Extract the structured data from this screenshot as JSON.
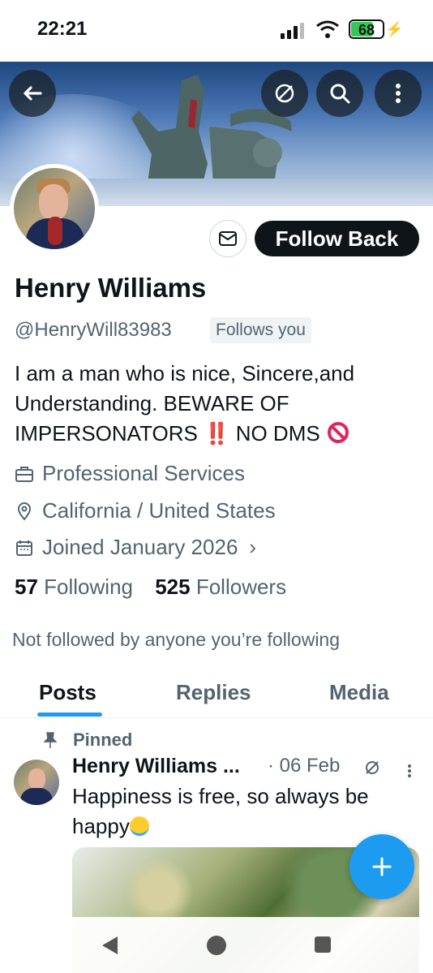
{
  "status_bar": {
    "time": "22:21",
    "battery_level": "68",
    "battery_fraction": 0.68
  },
  "profile": {
    "name": "Henry Williams",
    "handle": "@HenryWill83983",
    "follows_you": "Follows you",
    "bio": {
      "line1": "I am a man who is nice, Sincere,and",
      "line2": "Understanding. BEWARE OF",
      "line3": "IMPERSONATORS",
      "line3_emoji": "‼️",
      "line3_tail": "NO DMS"
    },
    "category": "Professional Services",
    "location": "California / United States",
    "joined": "Joined January 2026",
    "following_count": "57",
    "following_label": "Following",
    "followers_count": "525",
    "followers_label": "Followers",
    "followed_by_note": "Not followed by anyone you’re following"
  },
  "actions": {
    "follow_back": "Follow Back"
  },
  "tabs": [
    "Posts",
    "Replies",
    "Media"
  ],
  "pinned_post": {
    "pinned_label": "Pinned",
    "author": "Henry Williams ...",
    "date": "· 06 Feb",
    "text_line1": "Happiness is free, so always be",
    "text_line2": "happy"
  },
  "icons": {
    "back": "back-arrow-icon",
    "grok": "grok-icon",
    "search": "search-icon",
    "more": "more-icon",
    "mail": "mail-icon",
    "compose": "plus-icon"
  },
  "colors": {
    "accent": "#1d9bf0",
    "button_dark": "#0f1419",
    "muted_text": "#536471"
  }
}
